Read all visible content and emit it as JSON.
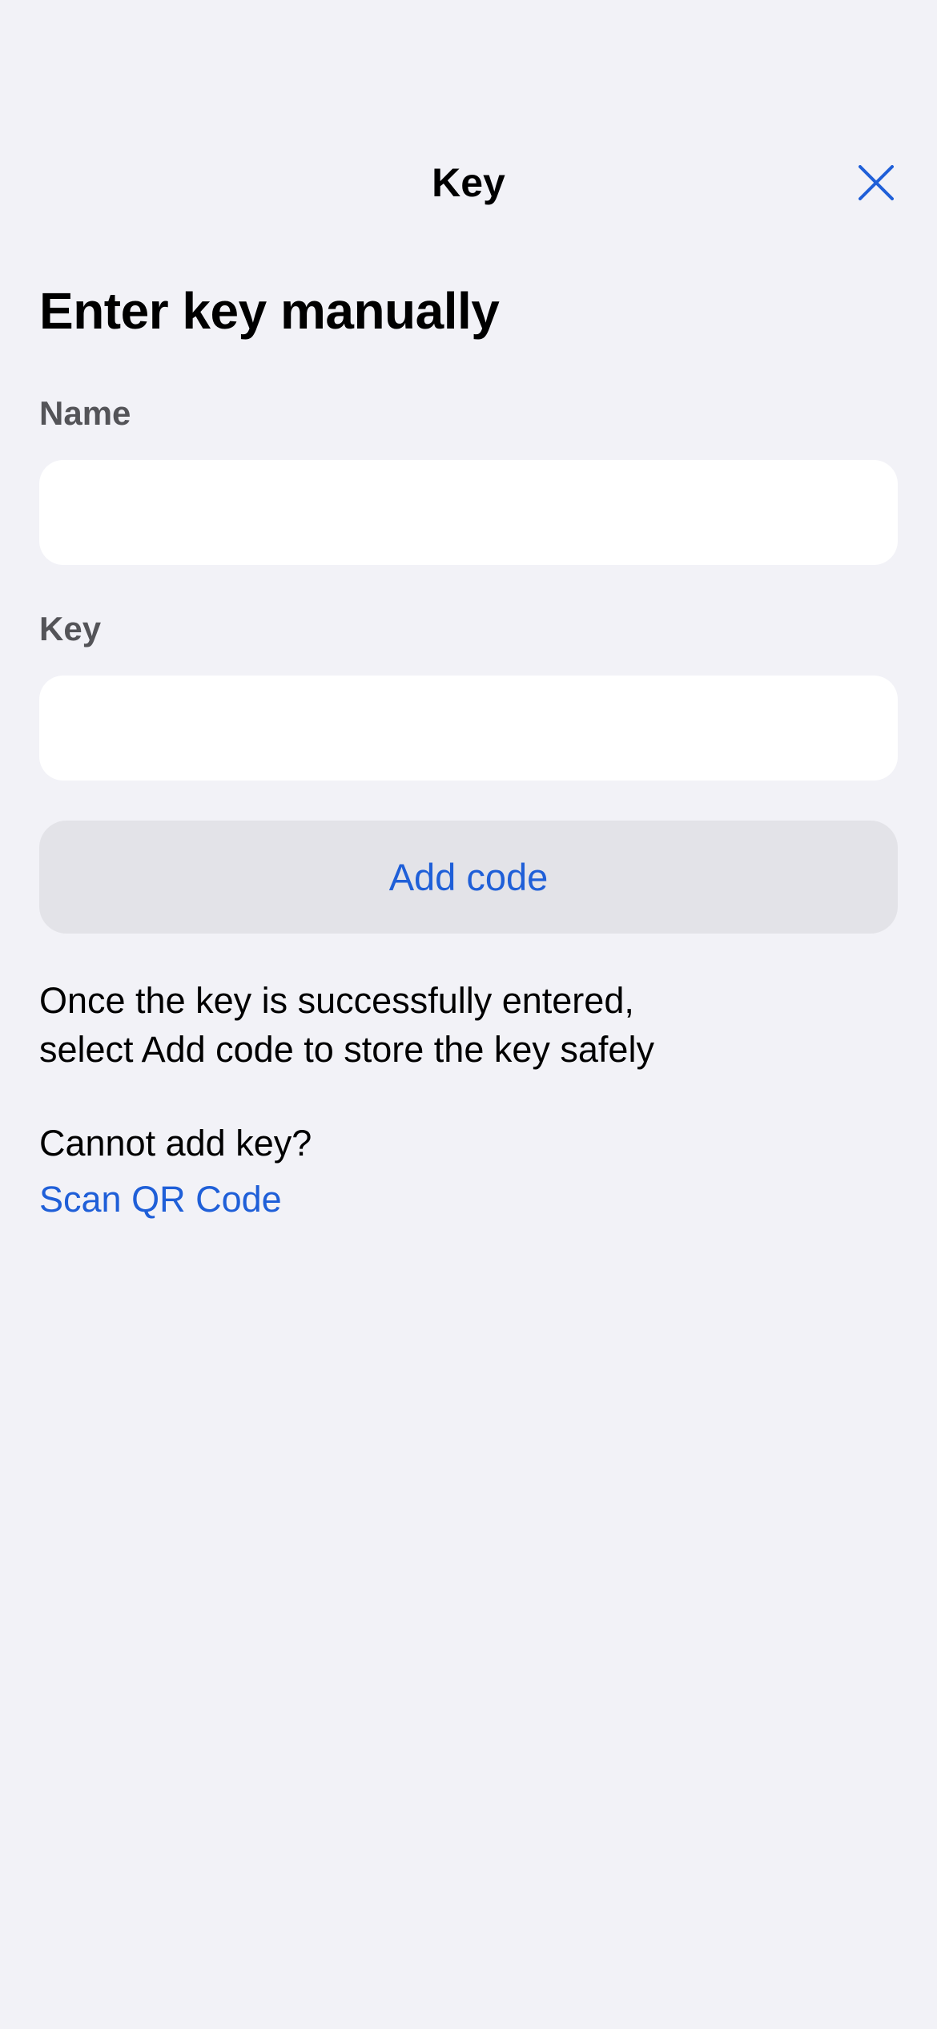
{
  "nav": {
    "title": "Key",
    "close_icon": "close-icon"
  },
  "heading": "Enter key manually",
  "form": {
    "name_label": "Name",
    "name_value": "",
    "key_label": "Key",
    "key_value": ""
  },
  "add_button": {
    "label": "Add code"
  },
  "info": {
    "line1": "Once the key is successfully entered,",
    "line2": "select Add code to store the key safely"
  },
  "fallback": {
    "question": "Cannot add key?",
    "link_label": "Scan QR Code"
  },
  "colors": {
    "background": "#f2f2f7",
    "accent": "#1f5fd8",
    "field_background": "#ffffff",
    "button_background": "#e3e3e8",
    "label_gray": "#545458"
  }
}
